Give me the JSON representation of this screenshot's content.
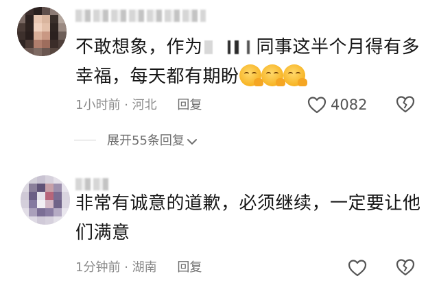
{
  "comments": [
    {
      "text_line1": "不敢想象，作为",
      "text_after_censor": "同事这半个月得有多",
      "text_line2": "幸福，每天都有期盼",
      "emoji_count": 3,
      "emoji_name": "laughing-crying-emoji",
      "time": "1小时前",
      "location": "河北",
      "separator": "·",
      "reply_label": "回复",
      "like_count": "4082",
      "expand_label": "展开55条回复"
    },
    {
      "text_line1": "非常有诚意的道歉，必须继续，一定要让他",
      "text_line2": "们满意",
      "time": "1分钟前",
      "location": "湖南",
      "separator": "·",
      "reply_label": "回复"
    }
  ],
  "icons": {
    "like": "heart-outline-icon",
    "dislike": "broken-heart-icon",
    "expand": "chevron-down-icon"
  },
  "colors": {
    "text": "#161616",
    "meta": "#8a8a8a",
    "icon": "#555555"
  }
}
